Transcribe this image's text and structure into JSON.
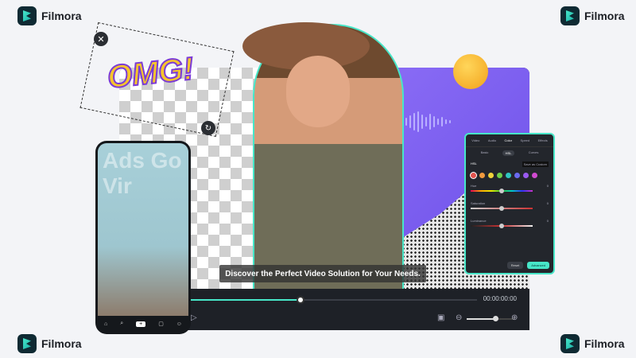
{
  "brand": {
    "name": "Filmora",
    "accent": "#47e6c8",
    "purple": "#7a5cf0"
  },
  "sticker": {
    "text": "OMG!"
  },
  "phone": {
    "overlay_text": "Ads Go Vir",
    "nav": [
      "home-icon",
      "search-icon",
      "add-icon",
      "inbox-icon",
      "profile-icon"
    ]
  },
  "editor": {
    "caption": "Discover the Perfect Video Solution for Your Needs.",
    "timecode": "00:00:00:00",
    "progress": 0.4,
    "zoom_level": 0.6
  },
  "panel": {
    "tabs": [
      "Video",
      "Audio",
      "Color",
      "Speed",
      "Effects"
    ],
    "active_tab": "Color",
    "subtabs": [
      "Basic",
      "HSL",
      "Curves"
    ],
    "active_subtab": "HSL",
    "save_label": "Save as Custom",
    "toggle_label": "HSL",
    "swatches": [
      "#e0524d",
      "#f09a3e",
      "#f0d23a",
      "#6fd04a",
      "#2fc6c0",
      "#6a6af0",
      "#9a5af0",
      "#d04ad0"
    ],
    "sliders": [
      {
        "label": "Hue",
        "value": "0"
      },
      {
        "label": "Saturation",
        "value": "0"
      },
      {
        "label": "Luminance",
        "value": "0"
      }
    ],
    "reset_label": "Reset",
    "advanced_label": "Advanced"
  }
}
